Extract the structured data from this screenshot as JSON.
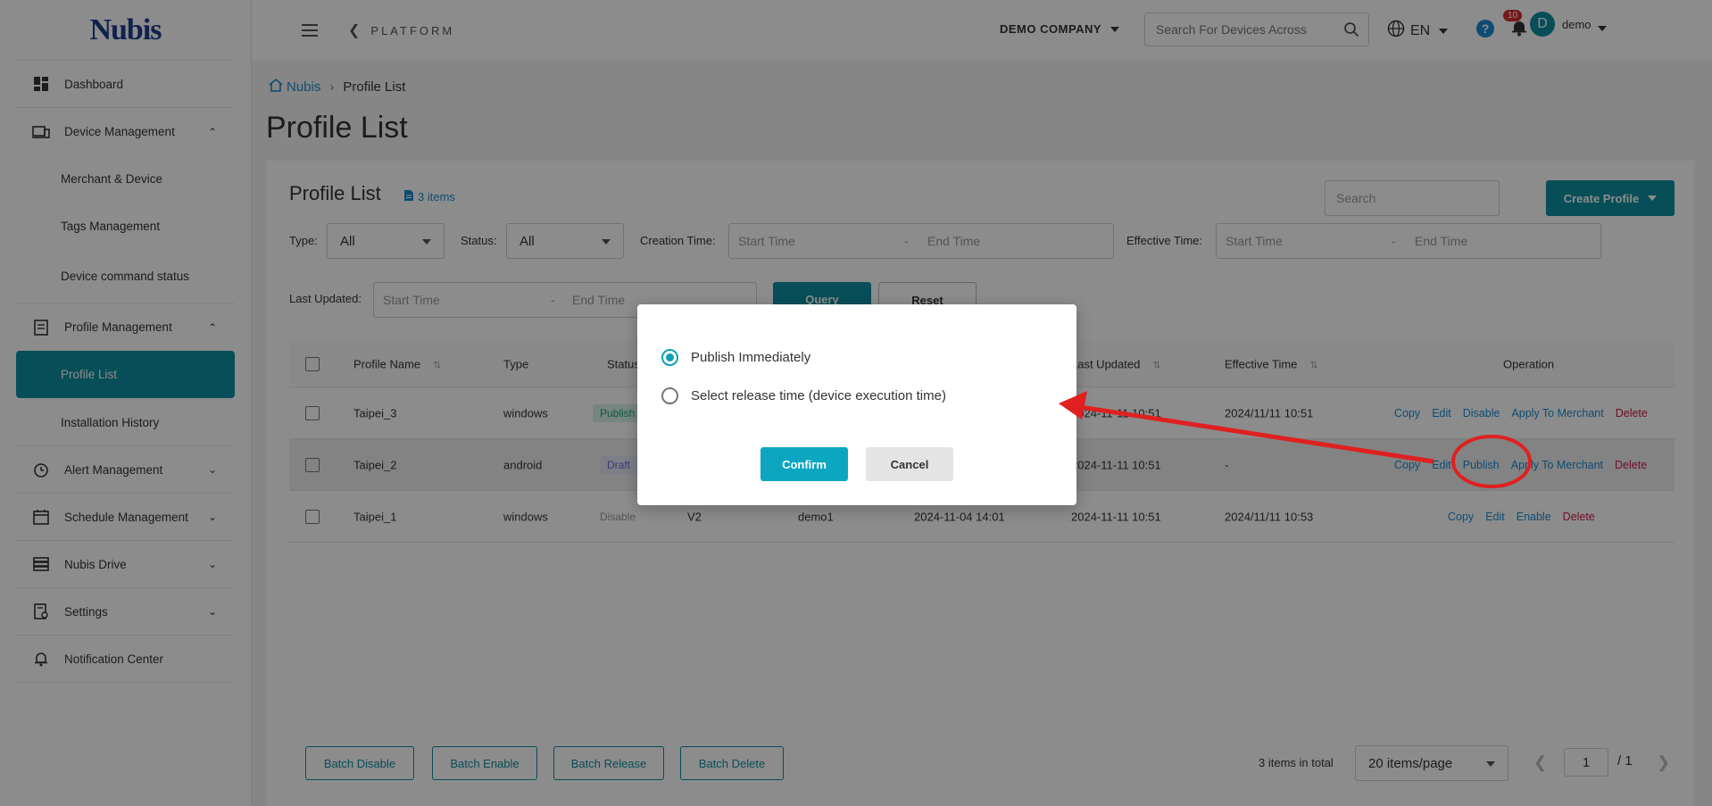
{
  "brand": {
    "logo_text": "Nubis"
  },
  "sidebar": {
    "items": [
      {
        "label": "Dashboard"
      },
      {
        "label": "Device Management"
      },
      {
        "label": "Merchant & Device"
      },
      {
        "label": "Tags Management"
      },
      {
        "label": "Device command status"
      },
      {
        "label": "Profile Management"
      },
      {
        "label": "Profile List"
      },
      {
        "label": "Installation History"
      },
      {
        "label": "Alert Management"
      },
      {
        "label": "Schedule Management"
      },
      {
        "label": "Nubis Drive"
      },
      {
        "label": "Settings"
      },
      {
        "label": "Notification Center"
      }
    ]
  },
  "topbar": {
    "platform": "PLATFORM",
    "company": "DEMO COMPANY",
    "search_placeholder": "Search For Devices Across",
    "language": "EN",
    "help": "?",
    "notifications": "10",
    "avatar_initial": "D",
    "username": "demo"
  },
  "breadcrumb": {
    "home": "Nubis",
    "current": "Profile List"
  },
  "page": {
    "title": "Profile List"
  },
  "card": {
    "title": "Profile List",
    "items_count": "3 items",
    "search_placeholder": "Search",
    "create_label": "Create Profile"
  },
  "filters": {
    "type_label": "Type:",
    "type_value": "All",
    "status_label": "Status:",
    "status_value": "All",
    "creation_label": "Creation Time:",
    "effective_label": "Effective Time:",
    "updated_label": "Last Updated:",
    "start": "Start Time",
    "end": "End Time",
    "dash": "-",
    "query": "Query",
    "reset": "Reset"
  },
  "table": {
    "headers": {
      "name": "Profile Name",
      "type": "Type",
      "status": "Status",
      "updated": "Last Updated",
      "effective": "Effective Time",
      "operation": "Operation"
    },
    "rows": [
      {
        "name": "Taipei_3",
        "type": "windows",
        "status": "Publish",
        "updated": "2024-11-11 10:51",
        "effective": "2024/11/11 10:51",
        "ops": [
          "Copy",
          "Edit",
          "Disable",
          "Apply To Merchant",
          "Delete"
        ]
      },
      {
        "name": "Taipei_2",
        "type": "android",
        "status": "Draft",
        "updated": "2024-11-11 10:51",
        "effective": "-",
        "ops": [
          "Copy",
          "Edit",
          "Publish",
          "Apply To Merchant",
          "Delete"
        ]
      },
      {
        "name": "Taipei_1",
        "type": "windows",
        "status": "Disable",
        "version": "V2",
        "creator": "demo1",
        "created": "2024-11-04 14:01",
        "updated": "2024-11-11 10:51",
        "effective": "2024/11/11 10:53",
        "ops": [
          "Copy",
          "Edit",
          "Enable",
          "Delete"
        ]
      }
    ]
  },
  "bottom": {
    "batch_disable": "Batch Disable",
    "batch_enable": "Batch Enable",
    "batch_release": "Batch Release",
    "batch_delete": "Batch Delete",
    "total": "3 items in total",
    "page_size": "20 items/page",
    "page": "1",
    "of": "/ 1"
  },
  "dialog": {
    "option_immediate": "Publish Immediately",
    "option_schedule": "Select release time (device execution time)",
    "confirm": "Confirm",
    "cancel": "Cancel"
  },
  "colors": {
    "primary": "#0d8fa0",
    "link": "#1b8bd1",
    "danger": "#d4184a",
    "annotation": "#e02020"
  }
}
